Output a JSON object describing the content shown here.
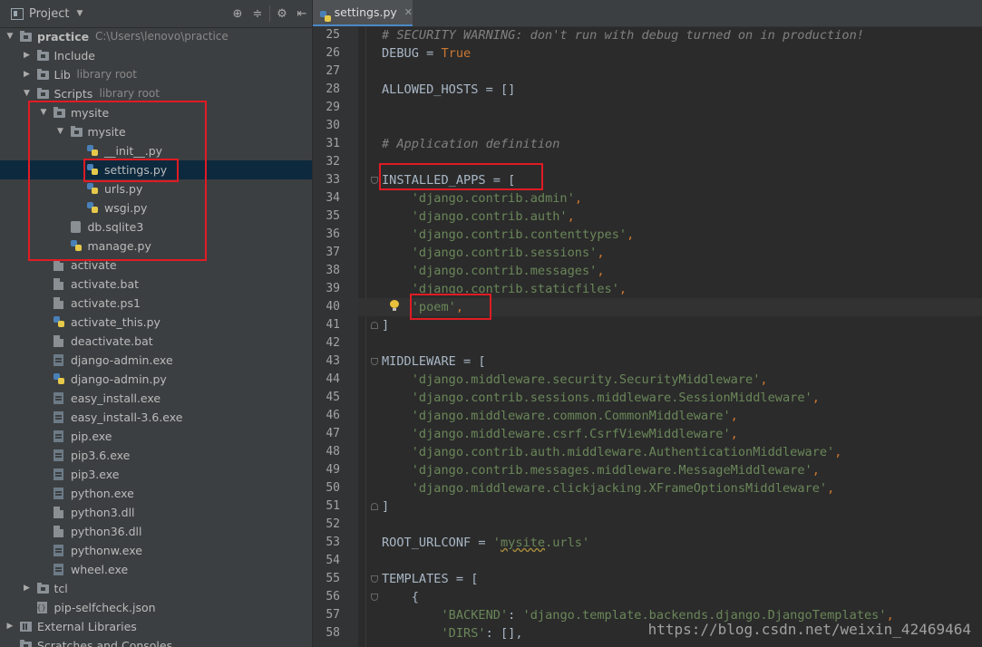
{
  "project_panel": {
    "title": "Project",
    "tree": [
      {
        "label": "practice",
        "sub": "C:\\Users\\lenovo\\practice",
        "icon": "folder",
        "arrow": "▼",
        "indent": 0,
        "bold": true
      },
      {
        "label": "Include",
        "icon": "folder",
        "arrow": "▶",
        "indent": 1
      },
      {
        "label": "Lib",
        "sub": "library root",
        "icon": "folder",
        "arrow": "▶",
        "indent": 1
      },
      {
        "label": "Scripts",
        "sub": "library root",
        "icon": "folder",
        "arrow": "▼",
        "indent": 1
      },
      {
        "label": "mysite",
        "icon": "folder",
        "arrow": "▼",
        "indent": 2
      },
      {
        "label": "mysite",
        "icon": "folder",
        "arrow": "▼",
        "indent": 3
      },
      {
        "label": "__init__.py",
        "icon": "py",
        "indent": 4
      },
      {
        "label": "settings.py",
        "icon": "py",
        "indent": 4,
        "selected": true
      },
      {
        "label": "urls.py",
        "icon": "py",
        "indent": 4
      },
      {
        "label": "wsgi.py",
        "icon": "py",
        "indent": 4
      },
      {
        "label": "db.sqlite3",
        "icon": "db",
        "indent": 3
      },
      {
        "label": "manage.py",
        "icon": "py",
        "indent": 3
      },
      {
        "label": "activate",
        "icon": "file",
        "indent": 2
      },
      {
        "label": "activate.bat",
        "icon": "file",
        "indent": 2
      },
      {
        "label": "activate.ps1",
        "icon": "file",
        "indent": 2
      },
      {
        "label": "activate_this.py",
        "icon": "py",
        "indent": 2
      },
      {
        "label": "deactivate.bat",
        "icon": "file",
        "indent": 2
      },
      {
        "label": "django-admin.exe",
        "icon": "exe",
        "indent": 2
      },
      {
        "label": "django-admin.py",
        "icon": "py",
        "indent": 2
      },
      {
        "label": "easy_install.exe",
        "icon": "exe",
        "indent": 2
      },
      {
        "label": "easy_install-3.6.exe",
        "icon": "exe",
        "indent": 2
      },
      {
        "label": "pip.exe",
        "icon": "exe",
        "indent": 2
      },
      {
        "label": "pip3.6.exe",
        "icon": "exe",
        "indent": 2
      },
      {
        "label": "pip3.exe",
        "icon": "exe",
        "indent": 2
      },
      {
        "label": "python.exe",
        "icon": "exe",
        "indent": 2
      },
      {
        "label": "python3.dll",
        "icon": "file",
        "indent": 2
      },
      {
        "label": "python36.dll",
        "icon": "file",
        "indent": 2
      },
      {
        "label": "pythonw.exe",
        "icon": "exe",
        "indent": 2
      },
      {
        "label": "wheel.exe",
        "icon": "exe",
        "indent": 2
      },
      {
        "label": "tcl",
        "icon": "folder",
        "arrow": "▶",
        "indent": 1
      },
      {
        "label": "pip-selfcheck.json",
        "icon": "json",
        "indent": 1
      },
      {
        "label": "External Libraries",
        "icon": "lib",
        "arrow": "▶",
        "indent": 0
      },
      {
        "label": "Scratches and Consoles",
        "icon": "folder",
        "indent": 0
      }
    ]
  },
  "editor": {
    "tab_label": "settings.py",
    "current_line": 40,
    "lines": [
      {
        "n": 25,
        "tokens": [
          {
            "t": "# SECURITY WARNING: don't run with debug turned on in production!",
            "c": "comment"
          }
        ]
      },
      {
        "n": 26,
        "tokens": [
          {
            "t": "DEBUG = ",
            "c": "plain"
          },
          {
            "t": "True",
            "c": "keyword"
          }
        ]
      },
      {
        "n": 27,
        "tokens": []
      },
      {
        "n": 28,
        "tokens": [
          {
            "t": "ALLOWED_HOSTS = []",
            "c": "plain"
          }
        ]
      },
      {
        "n": 29,
        "tokens": []
      },
      {
        "n": 30,
        "tokens": []
      },
      {
        "n": 31,
        "tokens": [
          {
            "t": "# Application definition",
            "c": "comment"
          }
        ]
      },
      {
        "n": 32,
        "tokens": []
      },
      {
        "n": 33,
        "tokens": [
          {
            "t": "INSTALLED_APPS = [",
            "c": "plain"
          }
        ],
        "fold": "start"
      },
      {
        "n": 34,
        "tokens": [
          {
            "t": "    ",
            "c": "plain"
          },
          {
            "t": "'django.contrib.admin'",
            "c": "string"
          },
          {
            "t": ",",
            "c": "keyword"
          }
        ]
      },
      {
        "n": 35,
        "tokens": [
          {
            "t": "    ",
            "c": "plain"
          },
          {
            "t": "'django.contrib.auth'",
            "c": "string"
          },
          {
            "t": ",",
            "c": "keyword"
          }
        ]
      },
      {
        "n": 36,
        "tokens": [
          {
            "t": "    ",
            "c": "plain"
          },
          {
            "t": "'django.contrib.contenttypes'",
            "c": "string"
          },
          {
            "t": ",",
            "c": "keyword"
          }
        ]
      },
      {
        "n": 37,
        "tokens": [
          {
            "t": "    ",
            "c": "plain"
          },
          {
            "t": "'django.contrib.sessions'",
            "c": "string"
          },
          {
            "t": ",",
            "c": "keyword"
          }
        ]
      },
      {
        "n": 38,
        "tokens": [
          {
            "t": "    ",
            "c": "plain"
          },
          {
            "t": "'django.contrib.messages'",
            "c": "string"
          },
          {
            "t": ",",
            "c": "keyword"
          }
        ]
      },
      {
        "n": 39,
        "tokens": [
          {
            "t": "    ",
            "c": "plain"
          },
          {
            "t": "'django.contrib.staticfiles'",
            "c": "string"
          },
          {
            "t": ",",
            "c": "keyword"
          }
        ]
      },
      {
        "n": 40,
        "tokens": [
          {
            "t": "    ",
            "c": "plain"
          },
          {
            "t": "'poem'",
            "c": "string"
          },
          {
            "t": ",",
            "c": "keyword"
          }
        ]
      },
      {
        "n": 41,
        "tokens": [
          {
            "t": "]",
            "c": "plain"
          }
        ],
        "fold": "end"
      },
      {
        "n": 42,
        "tokens": []
      },
      {
        "n": 43,
        "tokens": [
          {
            "t": "MIDDLEWARE = [",
            "c": "plain"
          }
        ],
        "fold": "start"
      },
      {
        "n": 44,
        "tokens": [
          {
            "t": "    ",
            "c": "plain"
          },
          {
            "t": "'django.middleware.security.SecurityMiddleware'",
            "c": "string"
          },
          {
            "t": ",",
            "c": "keyword"
          }
        ]
      },
      {
        "n": 45,
        "tokens": [
          {
            "t": "    ",
            "c": "plain"
          },
          {
            "t": "'django.contrib.sessions.middleware.SessionMiddleware'",
            "c": "string"
          },
          {
            "t": ",",
            "c": "keyword"
          }
        ]
      },
      {
        "n": 46,
        "tokens": [
          {
            "t": "    ",
            "c": "plain"
          },
          {
            "t": "'django.middleware.common.CommonMiddleware'",
            "c": "string"
          },
          {
            "t": ",",
            "c": "keyword"
          }
        ]
      },
      {
        "n": 47,
        "tokens": [
          {
            "t": "    ",
            "c": "plain"
          },
          {
            "t": "'django.middleware.csrf.CsrfViewMiddleware'",
            "c": "string"
          },
          {
            "t": ",",
            "c": "keyword"
          }
        ]
      },
      {
        "n": 48,
        "tokens": [
          {
            "t": "    ",
            "c": "plain"
          },
          {
            "t": "'django.contrib.auth.middleware.AuthenticationMiddleware'",
            "c": "string"
          },
          {
            "t": ",",
            "c": "keyword"
          }
        ]
      },
      {
        "n": 49,
        "tokens": [
          {
            "t": "    ",
            "c": "plain"
          },
          {
            "t": "'django.contrib.messages.middleware.MessageMiddleware'",
            "c": "string"
          },
          {
            "t": ",",
            "c": "keyword"
          }
        ]
      },
      {
        "n": 50,
        "tokens": [
          {
            "t": "    ",
            "c": "plain"
          },
          {
            "t": "'django.middleware.clickjacking.XFrameOptionsMiddleware'",
            "c": "string"
          },
          {
            "t": ",",
            "c": "keyword"
          }
        ]
      },
      {
        "n": 51,
        "tokens": [
          {
            "t": "]",
            "c": "plain"
          }
        ],
        "fold": "end"
      },
      {
        "n": 52,
        "tokens": []
      },
      {
        "n": 53,
        "tokens": [
          {
            "t": "ROOT_URLCONF = ",
            "c": "plain"
          },
          {
            "t": "'",
            "c": "string"
          },
          {
            "t": "mysite",
            "c": "squig"
          },
          {
            "t": ".urls'",
            "c": "string"
          }
        ]
      },
      {
        "n": 54,
        "tokens": []
      },
      {
        "n": 55,
        "tokens": [
          {
            "t": "TEMPLATES = [",
            "c": "plain"
          }
        ],
        "fold": "start"
      },
      {
        "n": 56,
        "tokens": [
          {
            "t": "    {",
            "c": "plain"
          }
        ],
        "fold": "start"
      },
      {
        "n": 57,
        "tokens": [
          {
            "t": "        ",
            "c": "plain"
          },
          {
            "t": "'BACKEND'",
            "c": "string"
          },
          {
            "t": ": ",
            "c": "plain"
          },
          {
            "t": "'django.template.backends.django.DjangoTemplates'",
            "c": "string"
          },
          {
            "t": ",",
            "c": "keyword"
          }
        ]
      },
      {
        "n": 58,
        "tokens": [
          {
            "t": "        ",
            "c": "plain"
          },
          {
            "t": "'DIRS'",
            "c": "string"
          },
          {
            "t": ": [], ",
            "c": "plain"
          }
        ]
      }
    ]
  },
  "watermark": "https://blog.csdn.net/weixin_42469464",
  "colors": {
    "highlight_box": "#e01b24",
    "selection": "#0d293e",
    "accent": "#4a88c7"
  }
}
